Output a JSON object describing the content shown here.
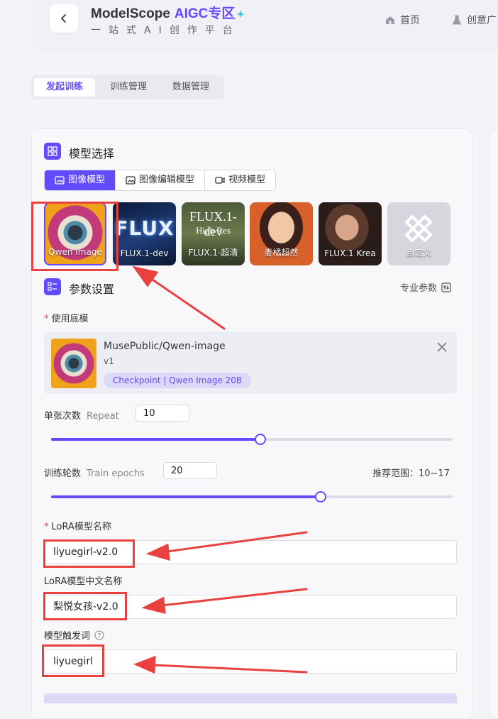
{
  "header": {
    "brand": "ModelScope",
    "brand_accent": "AIGC专区",
    "slogan": "一站式AI创作平台",
    "nav": [
      {
        "label": "首页",
        "icon": "home-icon"
      },
      {
        "label": "创意广",
        "icon": "flask-icon"
      }
    ],
    "accent_color": "#624aff"
  },
  "tabs": [
    {
      "label": "发起训练",
      "active": true
    },
    {
      "label": "训练管理",
      "active": false
    },
    {
      "label": "数据管理",
      "active": false
    }
  ],
  "model_section": {
    "title": "模型选择",
    "types": [
      {
        "label": "图像模型",
        "icon": "image-icon",
        "active": true
      },
      {
        "label": "图像编辑模型",
        "icon": "image-edit-icon",
        "active": false
      },
      {
        "label": "视频模型",
        "icon": "video-icon",
        "active": false
      }
    ],
    "models": [
      {
        "label": "Qwen Image",
        "selected": true
      },
      {
        "label": "FLUX.1-dev",
        "art": "FLUX"
      },
      {
        "label": "FLUX.1-超清",
        "art": "FLUX.1-dev",
        "art2": "High Res"
      },
      {
        "label": "麦橘超然"
      },
      {
        "label": "FLUX.1 Krea"
      },
      {
        "label": "自定义",
        "icon": "pencil-ruler-icon"
      }
    ]
  },
  "params_section": {
    "title": "参数设置",
    "pro_label": "专业参数",
    "base_model": {
      "label": "使用底模",
      "name": "MusePublic/Qwen-image",
      "version": "v1",
      "tag": "Checkpoint | Qwen Image 20B"
    },
    "repeat": {
      "label": "单张次数",
      "hint": "Repeat",
      "value": "10",
      "level": 0.52
    },
    "epochs": {
      "label": "训练轮数",
      "hint": "Train epochs",
      "value": "20",
      "range_label": "推荐范围：10~17",
      "level": 0.67
    },
    "lora_name": {
      "label": "LoRA模型名称",
      "value": "liyuegirl-v2.0"
    },
    "lora_cn_name": {
      "label": "LoRA模型中文名称",
      "value": "梨悦女孩-v2.0"
    },
    "trigger": {
      "label": "模型触发词",
      "value": "liyuegirl"
    }
  }
}
